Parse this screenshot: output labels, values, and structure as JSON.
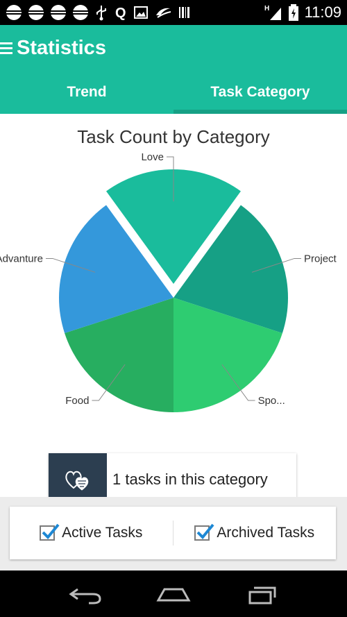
{
  "status_bar": {
    "time": "11:09",
    "network": "H"
  },
  "app_bar": {
    "title": "Statistics"
  },
  "tabs": [
    {
      "label": "Trend",
      "active": false
    },
    {
      "label": "Task Category",
      "active": true
    }
  ],
  "chart_data": {
    "type": "pie",
    "title": "Task Count by Category",
    "labels": [
      "Project",
      "Spo...",
      "Food",
      "Advanture",
      "Love"
    ],
    "values": [
      1,
      1,
      1,
      1,
      1
    ],
    "colors": [
      "#16a085",
      "#2ecc71",
      "#27ae60",
      "#3498db",
      "#1abc9c"
    ],
    "exploded": "Love"
  },
  "info_card": {
    "text": "1 tasks in this category",
    "icon": "hearts-icon"
  },
  "filters": [
    {
      "label": "Active Tasks",
      "checked": true
    },
    {
      "label": "Archived Tasks",
      "checked": true
    }
  ],
  "colors": {
    "accent": "#1abc9c",
    "accent_dark": "#16a085",
    "card_icon_bg": "#2c3e50",
    "check": "#1e88d4"
  }
}
